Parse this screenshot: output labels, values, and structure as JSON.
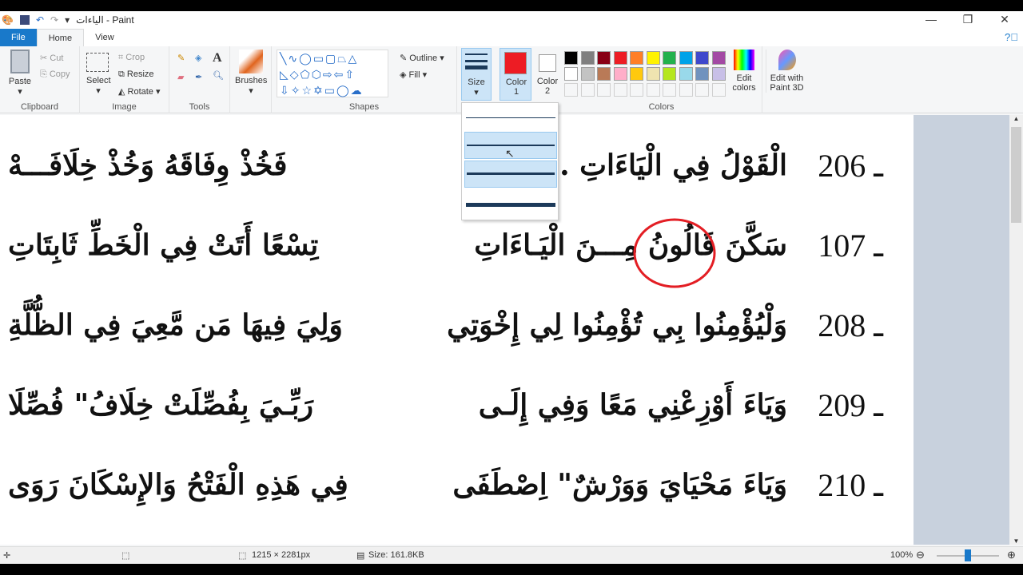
{
  "window": {
    "title": "الياءات - Paint",
    "minimize": "—",
    "restore": "❐",
    "close": "✕"
  },
  "tabs": [
    {
      "label": "File"
    },
    {
      "label": "Home"
    },
    {
      "label": "View"
    }
  ],
  "ribbon": {
    "clipboard": {
      "paste": "Paste",
      "cut": "Cut",
      "copy": "Copy",
      "label": "Clipboard"
    },
    "image": {
      "select": "Select",
      "crop": "Crop",
      "resize": "Resize",
      "rotate": "Rotate",
      "label": "Image"
    },
    "tools": {
      "label": "Tools",
      "text_tool": "A"
    },
    "brushes": {
      "label": "Brushes"
    },
    "shapes": {
      "label": "Shapes",
      "outline": "Outline",
      "fill": "Fill"
    },
    "size": {
      "label": "Size"
    },
    "color1": {
      "label": "Color 1",
      "color": "#ed1c24"
    },
    "color2": {
      "label": "Color 2",
      "color": "#ffffff"
    },
    "colors": {
      "label": "Colors",
      "palette_row1": [
        "#000000",
        "#7f7f7f",
        "#880015",
        "#ed1c24",
        "#ff7f27",
        "#fff200",
        "#22b14c",
        "#00a2e8",
        "#3f48cc",
        "#a349a4"
      ],
      "palette_row2": [
        "#ffffff",
        "#c3c3c3",
        "#b97a57",
        "#ffaec9",
        "#ffc90e",
        "#efe4b0",
        "#b5e61d",
        "#99d9ea",
        "#7092be",
        "#c8bfe7"
      ]
    },
    "edit_colors": "Edit colors",
    "paint3d": "Edit with Paint 3D"
  },
  "canvas": {
    "lines": [
      {
        "num": "206 ـ",
        "h1": "الْقَوْلُ فِي الْيَاءَاتِ ...هْ",
        "h2": "فَخُذْ وِفَاقَهُ وَخُذْ خِلَافَـــهْ"
      },
      {
        "num": "107 ـ",
        "h1": "سَكَّنَ قَالُونُ مِـــنَ الْيَـاءَاتِ",
        "h2": "تِسْعًا أَتَتْ فِي الْخَطِّ ثَابِتَاتِ"
      },
      {
        "num": "208 ـ",
        "h1": "وَلْيُؤْمِنُوا بِي تُؤْمِنُوا لِي إِخْوَتِي",
        "h2": "وَلِيَ فِيهَا مَن مَّعِيَ فِي الظُّلَّةِ"
      },
      {
        "num": "209 ـ",
        "h1": "وَيَاءَ أَوْزِعْنِي مَعًا وَفِي إِلَـى",
        "h2": "رَبِّـيَ بِفُصِّلَتْ خِلَافُ\" فُصِّلَا"
      },
      {
        "num": "210 ـ",
        "h1": "وَيَاءَ مَحْيَايَ وَوَرْشٌ\" اِصْطَفَى",
        "h2": "فِي هَذِهِ الْفَتْحُ وَالإِسْكَانَ رَوَى"
      }
    ],
    "annotation_color": "#e31e24"
  },
  "status": {
    "dimensions": "1215 × 2281px",
    "size": "Size: 161.8KB",
    "zoom": "100%",
    "zoom_level_percent": 100
  }
}
